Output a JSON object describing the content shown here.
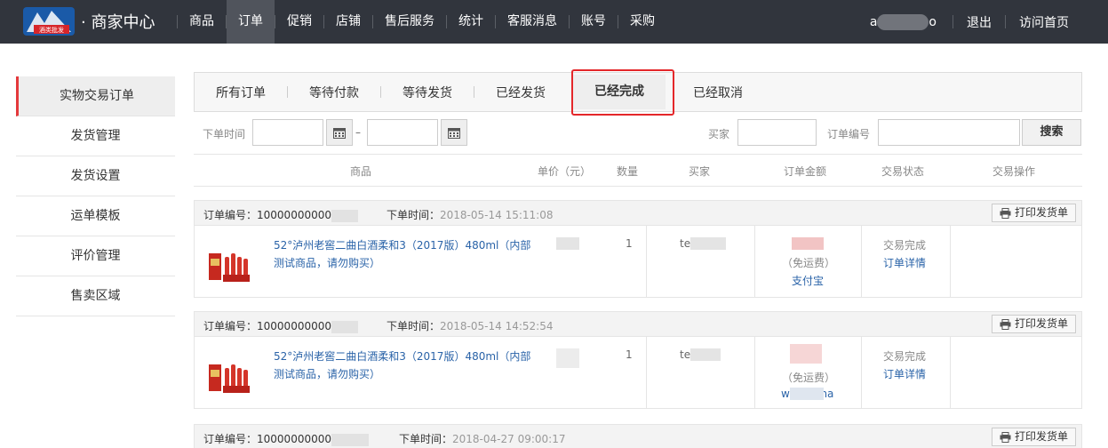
{
  "header": {
    "brand": "· 商家中心",
    "logo_text": "酒类批发",
    "nav": [
      {
        "label": "商品",
        "active": false
      },
      {
        "label": "订单",
        "active": true
      },
      {
        "label": "促销",
        "active": false
      },
      {
        "label": "店铺",
        "active": false
      },
      {
        "label": "售后服务",
        "active": false
      },
      {
        "label": "统计",
        "active": false
      },
      {
        "label": "客服消息",
        "active": false
      },
      {
        "label": "账号",
        "active": false
      },
      {
        "label": "采购",
        "active": false
      }
    ],
    "user_prefix": "a",
    "user_suffix": "o",
    "logout": "退出",
    "visit_home": "访问首页"
  },
  "sidebar": {
    "items": [
      "实物交易订单",
      "发货管理",
      "发货设置",
      "运单模板",
      "评价管理",
      "售卖区域"
    ],
    "active_index": 0
  },
  "tabs": {
    "items": [
      "所有订单",
      "等待付款",
      "等待发货",
      "已经发货",
      "已经完成",
      "已经取消"
    ],
    "active_index": 4
  },
  "filter": {
    "order_time_label": "下单时间",
    "range_sep": "–",
    "buyer_label": "买家",
    "order_no_label": "订单编号",
    "search_button": "搜索"
  },
  "table_header": [
    "商品",
    "单价（元）",
    "数量",
    "买家",
    "订单金额",
    "交易状态",
    "交易操作"
  ],
  "orders": [
    {
      "order_no_label": "订单编号：",
      "order_no": "10000000000",
      "time_label": "下单时间：",
      "time": "2018-05-14 15:11:08",
      "print_label": "打印发货单",
      "product_title": "52°泸州老窖二曲白酒柔和3（2017版）480ml（内部测试商品，请勿购买）",
      "quantity": "1",
      "buyer_prefix": "te",
      "shipping": "（免运费）",
      "payment": "支付宝",
      "status": "交易完成",
      "detail_link": "订单详情"
    },
    {
      "order_no_label": "订单编号：",
      "order_no": "10000000000",
      "time_label": "下单时间：",
      "time": "2018-05-14 14:52:54",
      "print_label": "打印发货单",
      "product_title": "52°泸州老窖二曲白酒柔和3（2017版）480ml（内部测试商品，请勿购买）",
      "quantity": "1",
      "buyer_prefix": "te",
      "shipping": "（免运费）",
      "payment": "w        ma",
      "status": "交易完成",
      "detail_link": "订单详情"
    },
    {
      "order_no_label": "订单编号：",
      "order_no": "10000000000",
      "time_label": "下单时间：",
      "time": "2018-04-27 09:00:17",
      "print_label": "打印发货单"
    }
  ],
  "colors": {
    "topbar": "#31353d",
    "accent_red": "#e4393c",
    "link_blue": "#2a63a8"
  }
}
